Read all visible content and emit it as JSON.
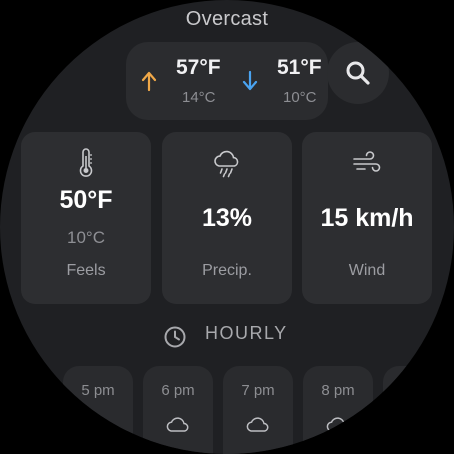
{
  "condition": "Overcast",
  "high": {
    "temp_f": "57°F",
    "temp_c": "14°C",
    "icon": "arrow-up-icon",
    "color": "#f0a848"
  },
  "low": {
    "temp_f": "51°F",
    "temp_c": "10°C",
    "icon": "arrow-down-icon",
    "color": "#4aa3f0"
  },
  "search": {
    "icon": "search-icon"
  },
  "cards": [
    {
      "main": "50°F",
      "alt": "10°C",
      "label": "Feels",
      "icon": "thermometer-icon"
    },
    {
      "main": "13%",
      "label": "Precip.",
      "icon": "rain-cloud-icon"
    },
    {
      "main": "15 km/h",
      "label": "Wind",
      "icon": "wind-icon"
    }
  ],
  "hourly": {
    "title": "HOURLY",
    "icon": "clock-icon",
    "items": [
      {
        "time": "5 pm",
        "icon": "cloud-icon"
      },
      {
        "time": "6 pm",
        "icon": "cloud-icon"
      },
      {
        "time": "7 pm",
        "icon": "cloud-icon"
      },
      {
        "time": "8 pm",
        "icon": "cloud-icon"
      }
    ]
  }
}
